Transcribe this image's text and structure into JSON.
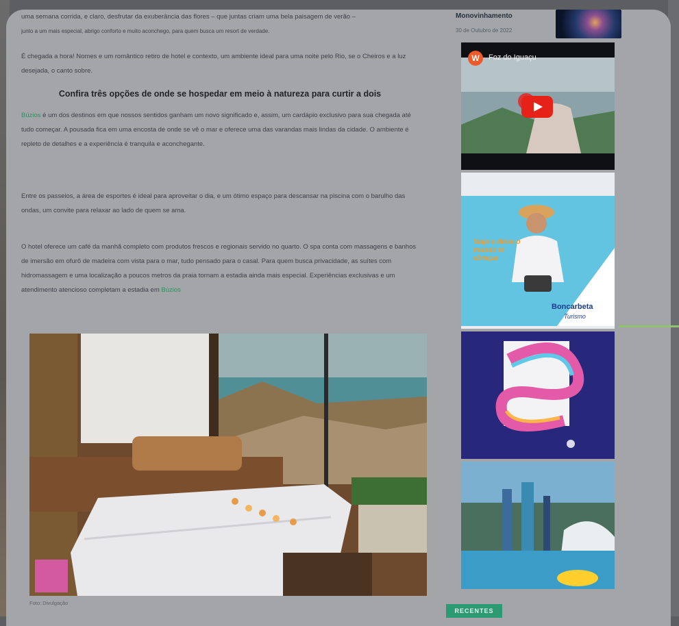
{
  "article": {
    "intro_lines": [
      "uma semana corrida, e claro, desfrutar da exuberância das flores – que juntas criam uma bela paisagem de verão –",
      "junto a um mais especial, abrigo conforto e muito aconchego, para quem busca um resort de verdade."
    ],
    "para2": "É chegada a hora! Nomes e um romântico retiro de hotel e contexto, um ambiente ideal para uma noite pelo Rio, se o Cheiros e a luz desejada, o canto sobre.",
    "section_heading": "Confira três opções de onde se hospedar em meio à natureza para curtir a dois",
    "para3_link": "Búzios",
    "para3": " é um dos destinos em que nossos sentidos ganham um novo significado e, assim, um cardápio exclusivo para sua chegada até tudo começar. A pousada fica em uma encosta de onde se vê o mar e oferece uma das varandas mais lindas da cidade. O ambiente é repleto de detalhes e a experiência é tranquila e aconchegante.",
    "para4": "Entre os passeios, a área de esportes é ideal para aproveitar o dia, e um ótimo espaço para descansar na piscina com o barulho das ondas, um convite para relaxar ao lado de quem se ama.",
    "para5_link": "Búzios",
    "para5": "O hotel oferece um café da manhã completo com produtos frescos e regionais servido no quarto. O spa conta com massagens e banhos de imersão em ofurô de madeira com vista para o mar, tudo pensado para o casal. Para quem busca privacidade, as suítes com hidromassagem e uma localização a poucos metros da praia tornam a estadia ainda mais especial. Experiências exclusivas e um atendimento atencioso completam a estadia em ",
    "photo_caption": "Foto: Divulgação"
  },
  "sidebar": {
    "news_title": "Monovinhamento",
    "news_date": "30 de Outubro de 2022",
    "video_title": "Foz do Iguaçu",
    "video_channel_letter": "W",
    "ad_brand_title": "Boncarbeta",
    "ad_brand_subtitle": "Turismo",
    "ad_tagline": "Viaje e deixe o mundo te abraçar"
  },
  "button": {
    "label": "RECENTES"
  },
  "colors": {
    "overlay": "#a3a5a9",
    "accent_green": "#2c9a72",
    "link_green": "#2f8f63",
    "youtube_red": "#e62117",
    "navy_ad": "#27277c"
  },
  "icons": [
    "youtube-play-icon",
    "channel-avatar-icon"
  ]
}
